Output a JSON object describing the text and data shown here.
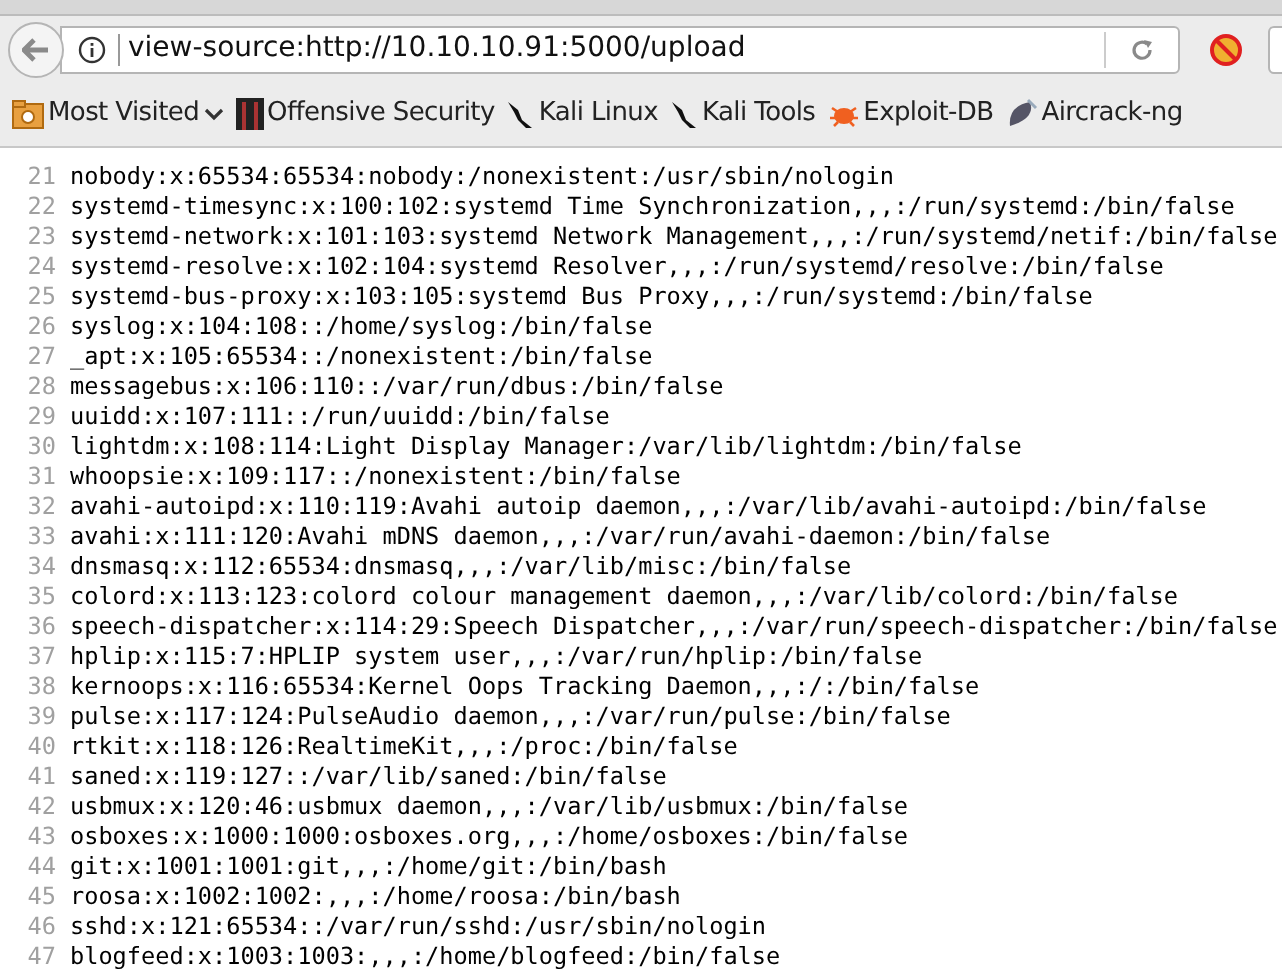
{
  "address_bar": {
    "url": "view-source:http://10.10.10.91:5000/upload"
  },
  "bookmarks": [
    {
      "label": "Most Visited",
      "kind": "menu"
    },
    {
      "label": "Offensive Security",
      "kind": "offsec"
    },
    {
      "label": "Kali Linux",
      "kind": "kali"
    },
    {
      "label": "Kali Tools",
      "kind": "kali"
    },
    {
      "label": "Exploit-DB",
      "kind": "bug"
    },
    {
      "label": "Aircrack-ng",
      "kind": "dish"
    }
  ],
  "source_lines": [
    {
      "number": "21",
      "text": "nobody:x:65534:65534:nobody:/nonexistent:/usr/sbin/nologin"
    },
    {
      "number": "22",
      "text": "systemd-timesync:x:100:102:systemd Time Synchronization,,,:/run/systemd:/bin/false"
    },
    {
      "number": "23",
      "text": "systemd-network:x:101:103:systemd Network Management,,,:/run/systemd/netif:/bin/false"
    },
    {
      "number": "24",
      "text": "systemd-resolve:x:102:104:systemd Resolver,,,:/run/systemd/resolve:/bin/false"
    },
    {
      "number": "25",
      "text": "systemd-bus-proxy:x:103:105:systemd Bus Proxy,,,:/run/systemd:/bin/false"
    },
    {
      "number": "26",
      "text": "syslog:x:104:108::/home/syslog:/bin/false"
    },
    {
      "number": "27",
      "text": "_apt:x:105:65534::/nonexistent:/bin/false"
    },
    {
      "number": "28",
      "text": "messagebus:x:106:110::/var/run/dbus:/bin/false"
    },
    {
      "number": "29",
      "text": "uuidd:x:107:111::/run/uuidd:/bin/false"
    },
    {
      "number": "30",
      "text": "lightdm:x:108:114:Light Display Manager:/var/lib/lightdm:/bin/false"
    },
    {
      "number": "31",
      "text": "whoopsie:x:109:117::/nonexistent:/bin/false"
    },
    {
      "number": "32",
      "text": "avahi-autoipd:x:110:119:Avahi autoip daemon,,,:/var/lib/avahi-autoipd:/bin/false"
    },
    {
      "number": "33",
      "text": "avahi:x:111:120:Avahi mDNS daemon,,,:/var/run/avahi-daemon:/bin/false"
    },
    {
      "number": "34",
      "text": "dnsmasq:x:112:65534:dnsmasq,,,:/var/lib/misc:/bin/false"
    },
    {
      "number": "35",
      "text": "colord:x:113:123:colord colour management daemon,,,:/var/lib/colord:/bin/false"
    },
    {
      "number": "36",
      "text": "speech-dispatcher:x:114:29:Speech Dispatcher,,,:/var/run/speech-dispatcher:/bin/false"
    },
    {
      "number": "37",
      "text": "hplip:x:115:7:HPLIP system user,,,:/var/run/hplip:/bin/false"
    },
    {
      "number": "38",
      "text": "kernoops:x:116:65534:Kernel Oops Tracking Daemon,,,:/:/bin/false"
    },
    {
      "number": "39",
      "text": "pulse:x:117:124:PulseAudio daemon,,,:/var/run/pulse:/bin/false"
    },
    {
      "number": "40",
      "text": "rtkit:x:118:126:RealtimeKit,,,:/proc:/bin/false"
    },
    {
      "number": "41",
      "text": "saned:x:119:127::/var/lib/saned:/bin/false"
    },
    {
      "number": "42",
      "text": "usbmux:x:120:46:usbmux daemon,,,:/var/lib/usbmux:/bin/false"
    },
    {
      "number": "43",
      "text": "osboxes:x:1000:1000:osboxes.org,,,:/home/osboxes:/bin/false"
    },
    {
      "number": "44",
      "text": "git:x:1001:1001:git,,,:/home/git:/bin/bash"
    },
    {
      "number": "45",
      "text": "roosa:x:1002:1002:,,,:/home/roosa:/bin/bash"
    },
    {
      "number": "46",
      "text": "sshd:x:121:65534::/var/run/sshd:/usr/sbin/nologin"
    },
    {
      "number": "47",
      "text": "blogfeed:x:1003:1003:,,,:/home/blogfeed:/bin/false"
    }
  ]
}
